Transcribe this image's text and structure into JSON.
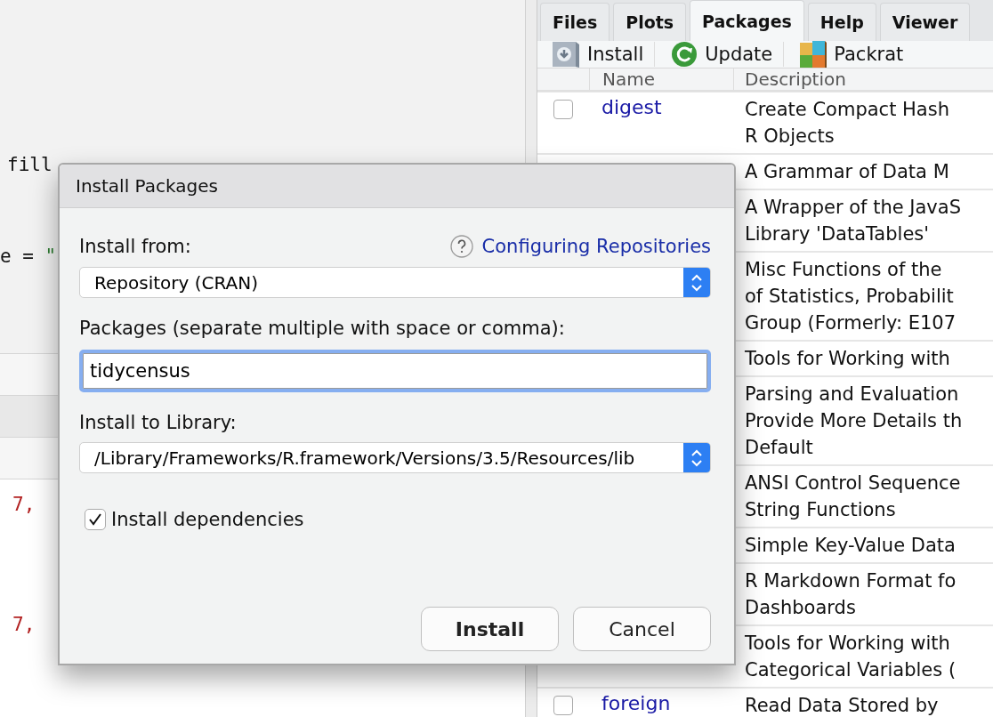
{
  "editor": {
    "top_lines": [
      [
        {
          "text": "fill",
          "kind": "plain"
        }
      ],
      [
        {
          "text": "e = ",
          "kind": "plain"
        },
        {
          "text": "\"",
          "kind": "string"
        }
      ]
    ],
    "console_lines": [
      [
        {
          "text": "7,",
          "kind": "number"
        }
      ],
      [
        {
          "text": "7,",
          "kind": "number"
        }
      ]
    ]
  },
  "pane": {
    "tabs": [
      {
        "label": "Files",
        "selected": false
      },
      {
        "label": "Plots",
        "selected": false
      },
      {
        "label": "Packages",
        "selected": true
      },
      {
        "label": "Help",
        "selected": false
      },
      {
        "label": "Viewer",
        "selected": false
      }
    ],
    "toolbar": [
      {
        "label": "Install",
        "kind": "install"
      },
      {
        "label": "Update",
        "kind": "update"
      },
      {
        "label": "Packrat",
        "kind": "packrat"
      }
    ],
    "table": {
      "columns": [
        "Name",
        "Description"
      ],
      "rows": [
        {
          "checked": false,
          "name": "digest",
          "description": [
            "Create Compact Hash",
            "R Objects"
          ]
        },
        {
          "description": [
            "A Grammar of Data M"
          ]
        },
        {
          "description": [
            "A Wrapper of the JavaS",
            "Library 'DataTables'"
          ]
        },
        {
          "description": [
            "Misc Functions of the",
            "of Statistics, Probabilit",
            "Group (Formerly: E107"
          ]
        },
        {
          "description": [
            "Tools for Working with"
          ]
        },
        {
          "description": [
            "Parsing and Evaluation",
            "Provide More Details th",
            "Default"
          ]
        },
        {
          "description": [
            "ANSI Control Sequence",
            "String Functions"
          ]
        },
        {
          "description": [
            "Simple Key-Value Data"
          ]
        },
        {
          "description": [
            "R Markdown Format fo",
            "Dashboards"
          ]
        },
        {
          "description": [
            "Tools for Working with",
            "Categorical Variables ("
          ]
        },
        {
          "checked": false,
          "name": "foreign",
          "description": [
            "Read Data Stored by"
          ]
        }
      ]
    }
  },
  "dialog": {
    "title": "Install Packages",
    "install_from_label": "Install from:",
    "help_link": "Configuring Repositories",
    "install_from": "Repository (CRAN)",
    "packages_label": "Packages (separate multiple with space or comma):",
    "packages_value": "tidycensus",
    "library_label": "Install to Library:",
    "library": "/Library/Frameworks/R.framework/Versions/3.5/Resources/lib",
    "dependencies": {
      "label": "Install dependencies",
      "checked": true
    },
    "buttons": [
      {
        "label": "Install",
        "kind": "default"
      },
      {
        "label": "Cancel",
        "kind": "normal"
      }
    ]
  }
}
